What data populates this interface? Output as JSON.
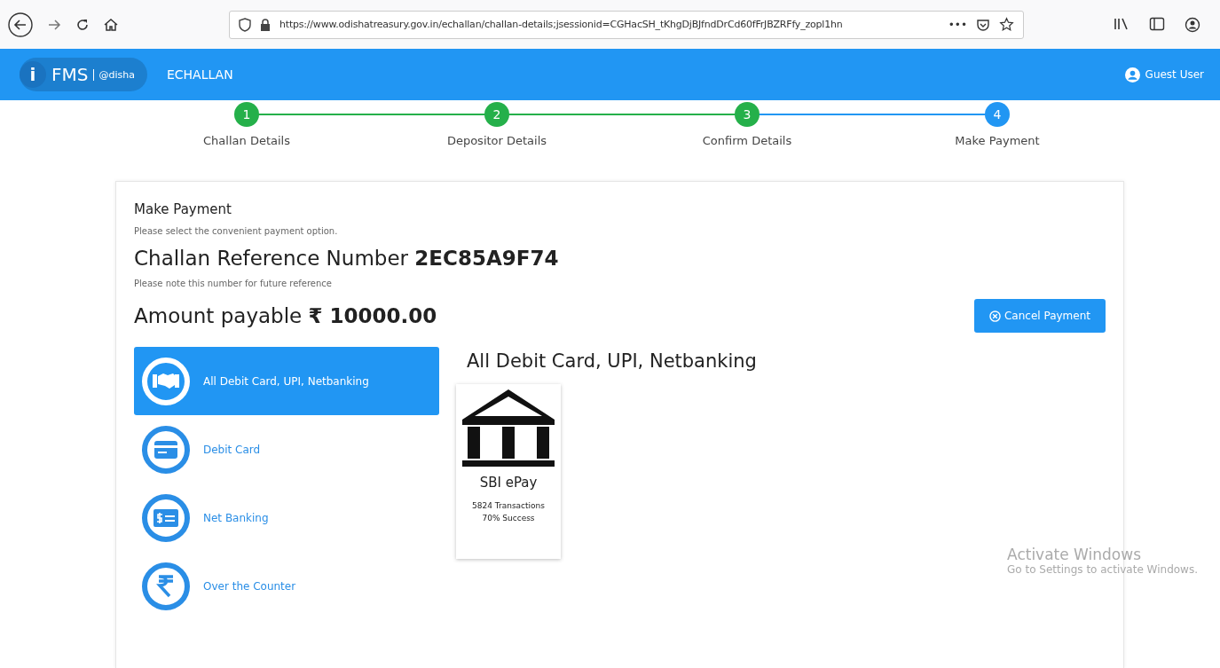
{
  "browser": {
    "url": "https://www.odishatreasury.gov.in/echallan/challan-details;jsessionid=CGHacSH_tKhgDjBJfndDrCd60fFrJBZRFfy_zopl1hn",
    "more": "•••"
  },
  "header": {
    "logo_letter": "i",
    "logo_text": "FMS",
    "logo_state": "@disha",
    "title": "ECHALLAN",
    "user": "Guest User"
  },
  "steps": [
    {
      "number": "1",
      "label": "Challan Details",
      "done": true
    },
    {
      "number": "2",
      "label": "Depositor Details",
      "done": true
    },
    {
      "number": "3",
      "label": "Confirm Details",
      "done": true
    },
    {
      "number": "4",
      "label": "Make Payment",
      "done": false
    }
  ],
  "card": {
    "title": "Make Payment",
    "subtitle": "Please select the convenient payment option.",
    "reference": "Challan Reference Number **2EC85A9F74**",
    "reference_note": "Please note this number for future reference",
    "amount": "Amount payable **₹ 10000.00**",
    "cancel_button": "Cancel Payment"
  },
  "payment_options": [
    {
      "kind": "handshake",
      "label": "All Debit Card, UPI, Netbanking",
      "selected": true
    },
    {
      "kind": "card",
      "label": "Debit Card",
      "selected": false
    },
    {
      "kind": "netbanking",
      "label": "Net Banking",
      "selected": false
    },
    {
      "kind": "rupee",
      "label": "Over the Counter",
      "selected": false
    }
  ],
  "panel": {
    "title": "All Debit Card, UPI, Netbanking",
    "gateways": [
      {
        "name": "SBI ePay",
        "transactions": "5824 Transactions",
        "success": "70% Success"
      }
    ]
  },
  "os_notice": {
    "title": "Activate Windows",
    "text": "Go to Settings to activate Windows."
  }
}
